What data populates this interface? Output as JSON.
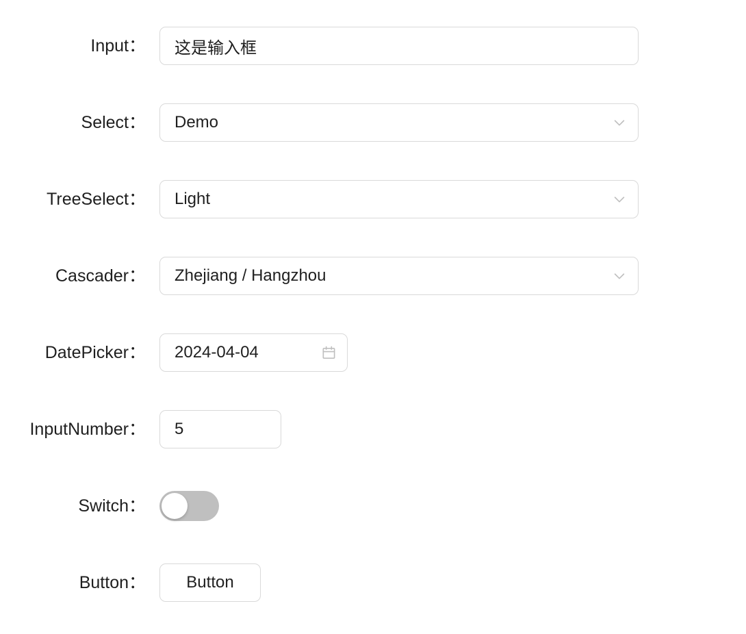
{
  "form": {
    "rows": [
      {
        "label": "Input：",
        "name": "input",
        "type": "input",
        "value": "这是输入框"
      },
      {
        "label": "Select：",
        "name": "select",
        "type": "select",
        "value": "Demo",
        "icon": "chevron-down-icon"
      },
      {
        "label": "TreeSelect：",
        "name": "tree-select",
        "type": "select",
        "value": "Light",
        "icon": "chevron-down-icon"
      },
      {
        "label": "Cascader：",
        "name": "cascader",
        "type": "select",
        "value": "Zhejiang / Hangzhou",
        "icon": "chevron-down-icon"
      },
      {
        "label": "DatePicker：",
        "name": "date-picker",
        "type": "date",
        "value": "2024-04-04",
        "icon": "calendar-icon"
      },
      {
        "label": "InputNumber：",
        "name": "input-number",
        "type": "number",
        "value": "5"
      },
      {
        "label": "Switch：",
        "name": "switch",
        "type": "switch",
        "value": "off"
      },
      {
        "label": "Button：",
        "name": "button",
        "type": "button",
        "value": "Button"
      }
    ]
  },
  "colors": {
    "border": "#d9d9d9",
    "text": "#1f1f1f",
    "icon": "#bfbfbf",
    "switch_track_off": "#bfbfbf",
    "switch_knob": "#ffffff",
    "background": "#ffffff"
  }
}
